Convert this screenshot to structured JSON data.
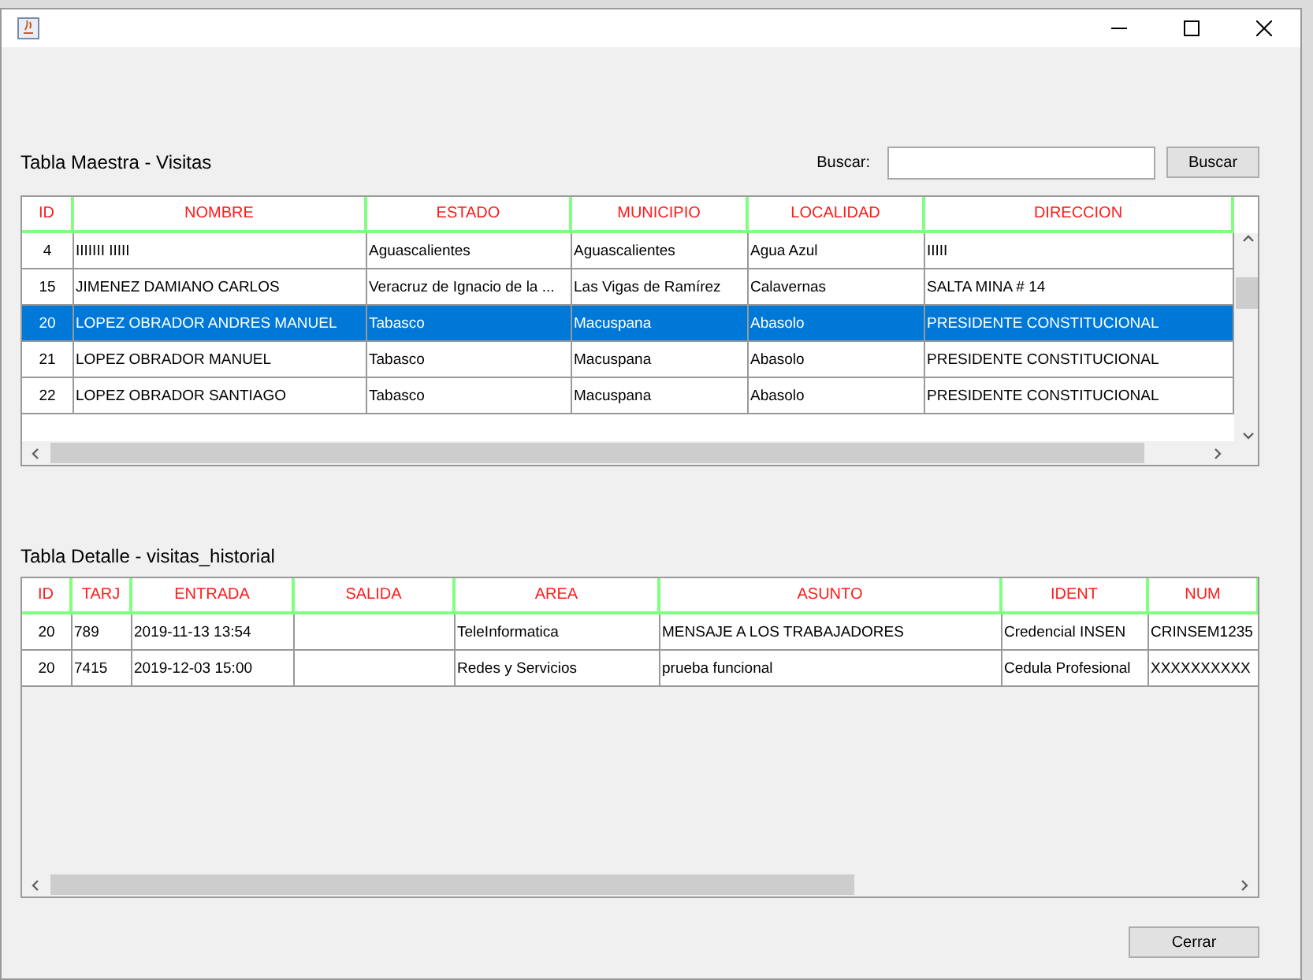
{
  "master": {
    "title": "Tabla Maestra - Visitas",
    "search_label": "Buscar:",
    "search_button": "Buscar",
    "columns": [
      "ID",
      "NOMBRE",
      "ESTADO",
      "MUNICIPIO",
      "LOCALIDAD",
      "DIRECCION"
    ],
    "rows": [
      {
        "cells": [
          "4",
          "IIIIIII IIIII",
          "Aguascalientes",
          "Aguascalientes",
          "Agua Azul",
          "IIIII"
        ],
        "selected": false
      },
      {
        "cells": [
          "15",
          "JIMENEZ DAMIANO CARLOS",
          "Veracruz de Ignacio de la ...",
          "Las Vigas de Ramírez",
          "Calavernas",
          "SALTA MINA # 14"
        ],
        "selected": false
      },
      {
        "cells": [
          "20",
          "LOPEZ OBRADOR ANDRES MANUEL",
          "Tabasco",
          "Macuspana",
          "Abasolo",
          "PRESIDENTE CONSTITUCIONAL"
        ],
        "selected": true
      },
      {
        "cells": [
          "21",
          "LOPEZ OBRADOR MANUEL",
          "Tabasco",
          "Macuspana",
          "Abasolo",
          "PRESIDENTE CONSTITUCIONAL"
        ],
        "selected": false
      },
      {
        "cells": [
          "22",
          "LOPEZ OBRADOR SANTIAGO",
          "Tabasco",
          "Macuspana",
          "Abasolo",
          "PRESIDENTE CONSTITUCIONAL"
        ],
        "selected": false
      }
    ]
  },
  "detail": {
    "title": "Tabla Detalle - visitas_historial",
    "columns": [
      "ID",
      "TARJ",
      "ENTRADA",
      "SALIDA",
      "AREA",
      "ASUNTO",
      "IDENT",
      "NUM"
    ],
    "rows": [
      {
        "cells": [
          "20",
          "789",
          "2019-11-13 13:54",
          "",
          "TeleInformatica",
          "MENSAJE A LOS TRABAJADORES",
          "Credencial INSEN",
          "CRINSEM1235"
        ],
        "selected": false
      },
      {
        "cells": [
          "20",
          "7415",
          "2019-12-03 15:00",
          "",
          "Redes y Servicios",
          "prueba funcional",
          "Cedula Profesional",
          "XXXXXXXXXX"
        ],
        "selected": false
      }
    ]
  },
  "close_button": "Cerrar"
}
